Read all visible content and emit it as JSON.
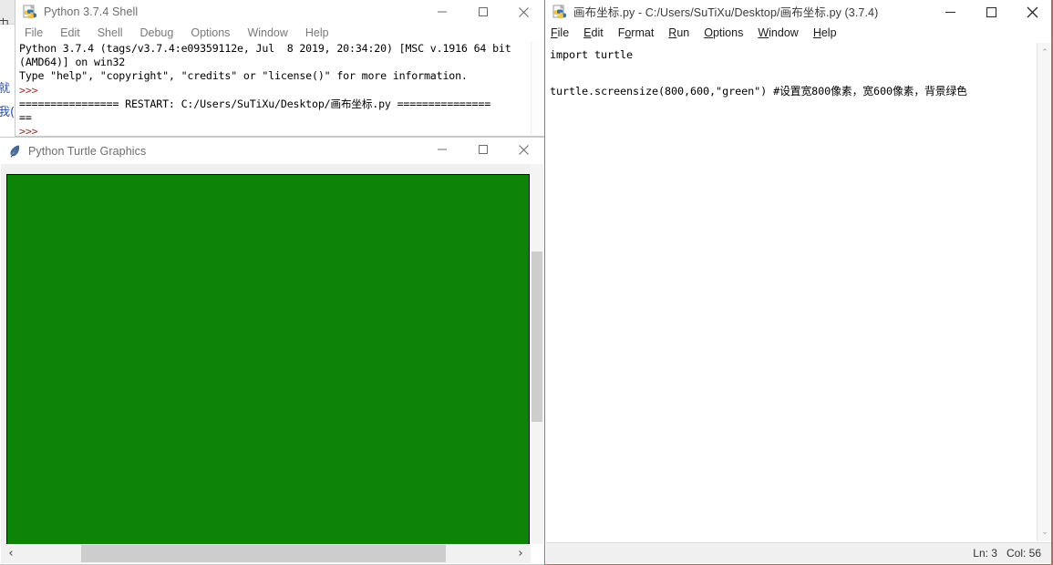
{
  "background_window": {
    "title_chars": "中",
    "body_chars": [
      "就",
      "我("
    ]
  },
  "shell_window": {
    "title": "Python 3.7.4 Shell",
    "icon": "python-idle-icon",
    "menus": [
      {
        "label": "File",
        "accel": ""
      },
      {
        "label": "Edit",
        "accel": ""
      },
      {
        "label": "Shell",
        "accel": ""
      },
      {
        "label": "Debug",
        "accel": ""
      },
      {
        "label": "Options",
        "accel": ""
      },
      {
        "label": "Window",
        "accel": ""
      },
      {
        "label": "Help",
        "accel": ""
      }
    ],
    "caption": {
      "minimize": "minimize",
      "maximize": "maximize",
      "close": "close"
    },
    "output_lines": [
      {
        "text": "Python 3.7.4 (tags/v3.7.4:e09359112e, Jul  8 2019, 20:34:20) [MSC v.1916 64 bit",
        "kind": "plain"
      },
      {
        "text": "(AMD64)] on win32",
        "kind": "plain"
      },
      {
        "text": "Type \"help\", \"copyright\", \"credits\" or \"license()\" for more information.",
        "kind": "plain"
      },
      {
        "text": ">>> ",
        "kind": "prompt"
      },
      {
        "text": "================ RESTART: C:/Users/SuTiXu/Desktop/画布坐标.py ===============",
        "kind": "plain"
      },
      {
        "text": "==",
        "kind": "plain"
      },
      {
        "text": ">>> ",
        "kind": "prompt"
      }
    ]
  },
  "turtle_window": {
    "title": "Python Turtle Graphics",
    "icon": "turtle-feather-icon",
    "canvas_color": "#0d8408",
    "caption": {
      "minimize": "minimize",
      "maximize": "maximize",
      "close": "close"
    },
    "hscroll": {
      "left_arrow": "‹",
      "right_arrow": "›"
    }
  },
  "editor_window": {
    "title": "画布坐标.py - C:/Users/SuTiXu/Desktop/画布坐标.py (3.7.4)",
    "icon": "python-idle-icon",
    "menus": [
      {
        "pre": "",
        "accel": "F",
        "post": "ile"
      },
      {
        "pre": "",
        "accel": "E",
        "post": "dit"
      },
      {
        "pre": "F",
        "accel": "o",
        "post": "rmat"
      },
      {
        "pre": "",
        "accel": "R",
        "post": "un"
      },
      {
        "pre": "",
        "accel": "O",
        "post": "ptions"
      },
      {
        "pre": "",
        "accel": "W",
        "post": "indow"
      },
      {
        "pre": "",
        "accel": "H",
        "post": "elp"
      }
    ],
    "caption": {
      "minimize": "minimize",
      "maximize": "maximize",
      "close": "close"
    },
    "code_lines": [
      "import turtle",
      "",
      "turtle.screensize(800,600,\"green\") #设置宽800像素，宽600像素，背景绿色"
    ],
    "status": "Ln: 3   Col: 56",
    "scroll": {
      "up_arrow": "⌃",
      "down_arrow": "⌄"
    }
  }
}
